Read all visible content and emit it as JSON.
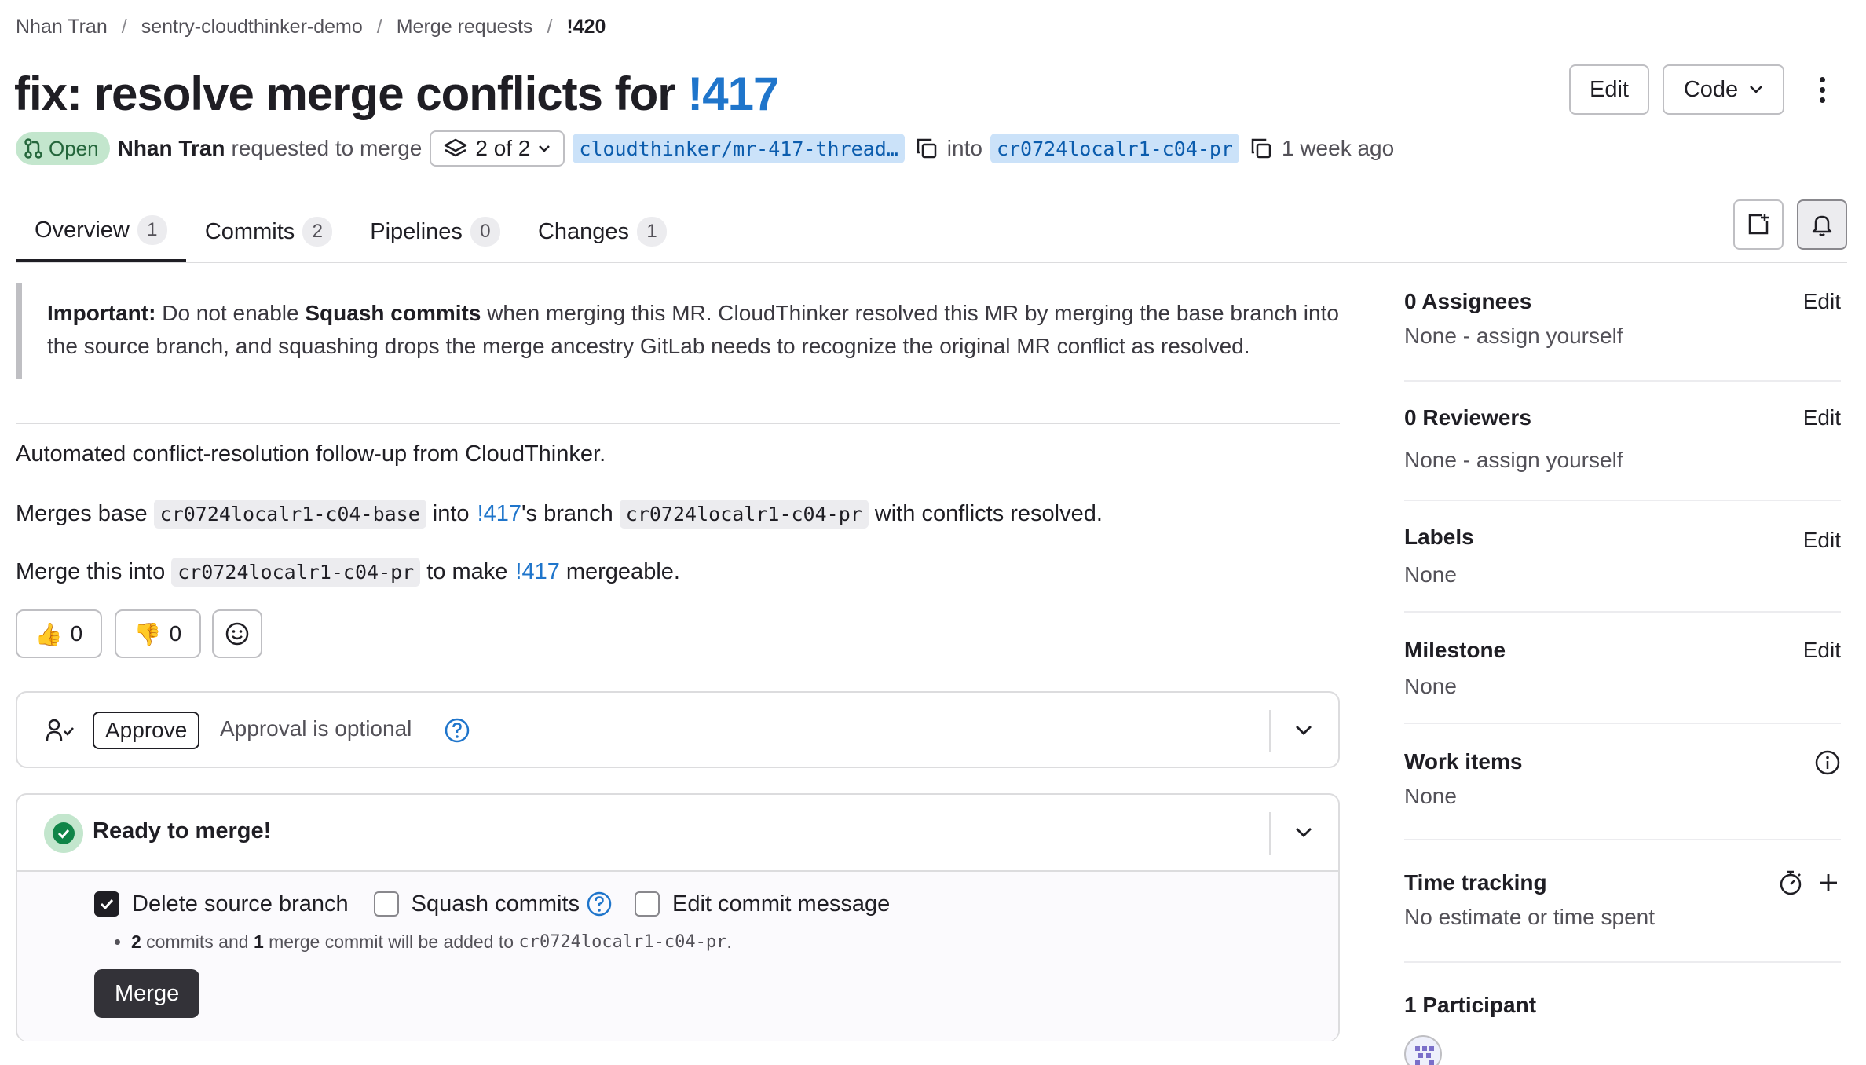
{
  "breadcrumb": [
    "Nhan Tran",
    "sentry-cloudthinker-demo",
    "Merge requests",
    "!420"
  ],
  "title": {
    "text": "fix: resolve merge conflicts for ",
    "link": "!417"
  },
  "header_buttons": {
    "edit": "Edit",
    "code": "Code"
  },
  "meta": {
    "status": "Open",
    "author": "Nhan Tran",
    "requested": "requested to merge",
    "stack": "2 of 2",
    "source_branch": "cloudthinker/mr-417-thread…",
    "into": "into",
    "target_branch": "cr0724localr1-c04-pr",
    "time": "1 week ago"
  },
  "tabs": [
    {
      "label": "Overview",
      "count": "1"
    },
    {
      "label": "Commits",
      "count": "2"
    },
    {
      "label": "Pipelines",
      "count": "0"
    },
    {
      "label": "Changes",
      "count": "1"
    }
  ],
  "description": {
    "note_important": "Important:",
    "note_a": " Do not enable ",
    "note_b": "Squash commits",
    "note_c": " when merging this MR. CloudThinker resolved this MR by merging the base branch into the source branch, and squashing drops the merge ancestry GitLab needs to recognize the original MR conflict as resolved.",
    "p1": "Automated conflict-resolution follow-up from CloudThinker.",
    "p2_a": "Merges base",
    "p2_code1": "cr0724localr1-c04-base",
    "p2_b": "into",
    "p2_link": "!417",
    "p2_c": "'s branch",
    "p2_code2": "cr0724localr1-c04-pr",
    "p2_d": "with conflicts resolved.",
    "p3_a": "Merge this into",
    "p3_code": "cr0724localr1-c04-pr",
    "p3_b": "to make",
    "p3_link": "!417",
    "p3_c": "mergeable."
  },
  "reactions": {
    "thumbs_up": "0",
    "thumbs_down": "0"
  },
  "approval": {
    "button": "Approve",
    "text": "Approval is optional"
  },
  "merge_widget": {
    "status": "Ready to merge!",
    "delete_source": "Delete source branch",
    "squash": "Squash commits",
    "edit_message": "Edit commit message",
    "delete_source_checked": true,
    "squash_checked": false,
    "edit_message_checked": false,
    "info_a": "2",
    "info_b": " commits and ",
    "info_c": "1",
    "info_d": " merge commit will be added to ",
    "info_branch": "cr0724localr1-c04-pr",
    "info_e": ".",
    "merge_button": "Merge"
  },
  "sidebar": {
    "assignees": {
      "title": "0 Assignees",
      "edit": "Edit",
      "value": "None - assign yourself"
    },
    "reviewers": {
      "title": "0 Reviewers",
      "edit": "Edit",
      "value": "None - assign yourself"
    },
    "labels": {
      "title": "Labels",
      "edit": "Edit",
      "value": "None"
    },
    "milestone": {
      "title": "Milestone",
      "edit": "Edit",
      "value": "None"
    },
    "work_items": {
      "title": "Work items",
      "value": "None"
    },
    "time_tracking": {
      "title": "Time tracking",
      "value": "No estimate or time spent"
    },
    "participants": {
      "title": "1 Participant"
    }
  },
  "colors": {
    "link": "#1f75cb",
    "open_badge_bg": "#c3e6cd",
    "open_badge_text": "#24663b",
    "success": "#108548",
    "merge_button": "#333238"
  }
}
